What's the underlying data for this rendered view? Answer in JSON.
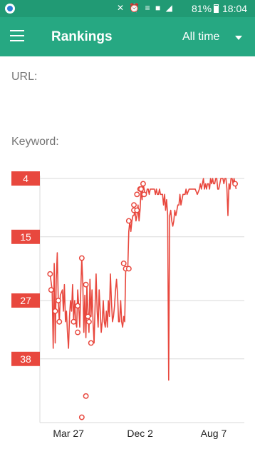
{
  "status_bar": {
    "icons": "✕ ⏰ ≡ ■ ◢",
    "battery": "81%",
    "time": "18:04"
  },
  "app_bar": {
    "title": "Rankings",
    "range_selected": "All time"
  },
  "fields": {
    "url_label": "URL:",
    "keyword_label": "Keyword:"
  },
  "colors": {
    "status_bar": "#219a74",
    "app_bar": "#26a882",
    "series": "#e8483e",
    "rank_badge": "#e8483e"
  },
  "icons": {
    "menu": "hamburger-menu-icon",
    "dropdown": "chevron-down-icon"
  },
  "chart_data": {
    "type": "line",
    "y_axis": "rank",
    "y_reversed": true,
    "y_ticks": [
      "4",
      "15",
      "27",
      "38"
    ],
    "y_tick_values": [
      4,
      15,
      27,
      38
    ],
    "ylim": [
      4,
      50
    ],
    "x_ticks": [
      "Mar 27",
      "Dec 2",
      "Aug 7"
    ],
    "x_tick_positions": [
      0.14,
      0.49,
      0.85
    ],
    "grid": true,
    "series": [
      {
        "points": [
          [
            0.05,
            22
          ],
          [
            0.06,
            25
          ],
          [
            0.065,
            36
          ],
          [
            0.07,
            20
          ],
          [
            0.075,
            35
          ],
          [
            0.08,
            23
          ],
          [
            0.085,
            18
          ],
          [
            0.09,
            27
          ],
          [
            0.095,
            31
          ],
          [
            0.1,
            26
          ],
          [
            0.11,
            25
          ],
          [
            0.115,
            29
          ],
          [
            0.12,
            24
          ],
          [
            0.125,
            31
          ],
          [
            0.13,
            29
          ],
          [
            0.135,
            33
          ],
          [
            0.14,
            36
          ],
          [
            0.145,
            30
          ],
          [
            0.15,
            27
          ],
          [
            0.155,
            29
          ],
          [
            0.16,
            24
          ],
          [
            0.165,
            31
          ],
          [
            0.17,
            27
          ],
          [
            0.175,
            31
          ],
          [
            0.18,
            32
          ],
          [
            0.185,
            25
          ],
          [
            0.19,
            28
          ],
          [
            0.195,
            32
          ],
          [
            0.2,
            25
          ],
          [
            0.205,
            19
          ],
          [
            0.21,
            24
          ],
          [
            0.215,
            33
          ],
          [
            0.22,
            26
          ],
          [
            0.225,
            34
          ],
          [
            0.23,
            24
          ],
          [
            0.235,
            29
          ],
          [
            0.24,
            33
          ],
          [
            0.245,
            23
          ],
          [
            0.25,
            30
          ],
          [
            0.255,
            25
          ],
          [
            0.26,
            31
          ],
          [
            0.265,
            35
          ],
          [
            0.27,
            28
          ],
          [
            0.275,
            22
          ],
          [
            0.28,
            29
          ],
          [
            0.285,
            32
          ],
          [
            0.29,
            25
          ],
          [
            0.295,
            29
          ],
          [
            0.3,
            33
          ],
          [
            0.305,
            31
          ],
          [
            0.31,
            27
          ],
          [
            0.315,
            31
          ],
          [
            0.32,
            32
          ],
          [
            0.325,
            29
          ],
          [
            0.33,
            32
          ],
          [
            0.335,
            27
          ],
          [
            0.34,
            30
          ],
          [
            0.345,
            22
          ],
          [
            0.35,
            27
          ],
          [
            0.355,
            31
          ],
          [
            0.36,
            30
          ],
          [
            0.365,
            28
          ],
          [
            0.37,
            25
          ],
          [
            0.375,
            23
          ],
          [
            0.38,
            26
          ],
          [
            0.385,
            31
          ],
          [
            0.39,
            31
          ],
          [
            0.395,
            27
          ],
          [
            0.4,
            31
          ],
          [
            0.405,
            32
          ],
          [
            0.41,
            30
          ],
          [
            0.415,
            31
          ],
          [
            0.42,
            21
          ],
          [
            0.425,
            21
          ],
          [
            0.43,
            21
          ],
          [
            0.435,
            14
          ],
          [
            0.44,
            12
          ],
          [
            0.445,
            14
          ],
          [
            0.45,
            12
          ],
          [
            0.455,
            11
          ],
          [
            0.46,
            11
          ],
          [
            0.465,
            10
          ],
          [
            0.47,
            12
          ],
          [
            0.475,
            11
          ],
          [
            0.48,
            9
          ],
          [
            0.485,
            12
          ],
          [
            0.49,
            10
          ],
          [
            0.495,
            6
          ],
          [
            0.5,
            8
          ],
          [
            0.505,
            5
          ],
          [
            0.51,
            6
          ],
          [
            0.515,
            7
          ],
          [
            0.52,
            7
          ],
          [
            0.525,
            6
          ],
          [
            0.53,
            6
          ],
          [
            0.535,
            7
          ],
          [
            0.54,
            6
          ],
          [
            0.545,
            6
          ],
          [
            0.55,
            6
          ],
          [
            0.555,
            6
          ],
          [
            0.56,
            6
          ],
          [
            0.565,
            7
          ],
          [
            0.57,
            6
          ],
          [
            0.575,
            7
          ],
          [
            0.58,
            7
          ],
          [
            0.585,
            6
          ],
          [
            0.59,
            7
          ],
          [
            0.6,
            7
          ],
          [
            0.605,
            9
          ],
          [
            0.61,
            7
          ],
          [
            0.615,
            10
          ],
          [
            0.62,
            8
          ],
          [
            0.625,
            11
          ],
          [
            0.63,
            42
          ],
          [
            0.635,
            11
          ],
          [
            0.64,
            10
          ],
          [
            0.645,
            12
          ],
          [
            0.65,
            13
          ],
          [
            0.655,
            12
          ],
          [
            0.66,
            10
          ],
          [
            0.665,
            11
          ],
          [
            0.67,
            10
          ],
          [
            0.675,
            9
          ],
          [
            0.68,
            9
          ],
          [
            0.685,
            7
          ],
          [
            0.69,
            9
          ],
          [
            0.695,
            8
          ],
          [
            0.7,
            7
          ],
          [
            0.705,
            7
          ],
          [
            0.71,
            7
          ],
          [
            0.715,
            6
          ],
          [
            0.72,
            7
          ],
          [
            0.73,
            6
          ],
          [
            0.74,
            6
          ],
          [
            0.75,
            6
          ],
          [
            0.76,
            6
          ],
          [
            0.77,
            7
          ],
          [
            0.78,
            6
          ],
          [
            0.785,
            5
          ],
          [
            0.79,
            6
          ],
          [
            0.8,
            4
          ],
          [
            0.805,
            6
          ],
          [
            0.81,
            5
          ],
          [
            0.815,
            6
          ],
          [
            0.82,
            5
          ],
          [
            0.825,
            5
          ],
          [
            0.83,
            6
          ],
          [
            0.835,
            4
          ],
          [
            0.84,
            5
          ],
          [
            0.845,
            4
          ],
          [
            0.85,
            5
          ],
          [
            0.855,
            5
          ],
          [
            0.86,
            4
          ],
          [
            0.865,
            4
          ],
          [
            0.87,
            6
          ],
          [
            0.875,
            6
          ],
          [
            0.88,
            5
          ],
          [
            0.885,
            4
          ],
          [
            0.89,
            4
          ],
          [
            0.895,
            4
          ],
          [
            0.9,
            5
          ],
          [
            0.905,
            4
          ],
          [
            0.91,
            4
          ],
          [
            0.915,
            6
          ],
          [
            0.92,
            11
          ],
          [
            0.925,
            5
          ],
          [
            0.93,
            6
          ],
          [
            0.935,
            4
          ],
          [
            0.94,
            4
          ],
          [
            0.945,
            5
          ],
          [
            0.95,
            4
          ],
          [
            0.955,
            5
          ],
          [
            0.96,
            6
          ]
        ],
        "markers": [
          [
            0.05,
            22
          ],
          [
            0.055,
            25
          ],
          [
            0.09,
            27
          ],
          [
            0.075,
            29
          ],
          [
            0.095,
            31
          ],
          [
            0.185,
            28
          ],
          [
            0.205,
            19
          ],
          [
            0.185,
            33
          ],
          [
            0.225,
            24
          ],
          [
            0.235,
            30
          ],
          [
            0.24,
            31
          ],
          [
            0.25,
            35
          ],
          [
            0.165,
            31
          ],
          [
            0.225,
            45
          ],
          [
            0.205,
            49
          ],
          [
            0.42,
            21
          ],
          [
            0.41,
            20
          ],
          [
            0.435,
            21
          ],
          [
            0.435,
            12
          ],
          [
            0.46,
            10
          ],
          [
            0.46,
            9
          ],
          [
            0.475,
            10
          ],
          [
            0.475,
            7
          ],
          [
            0.49,
            6
          ],
          [
            0.505,
            5
          ],
          [
            0.495,
            6
          ],
          [
            0.51,
            7
          ],
          [
            0.955,
            5
          ]
        ]
      }
    ]
  }
}
